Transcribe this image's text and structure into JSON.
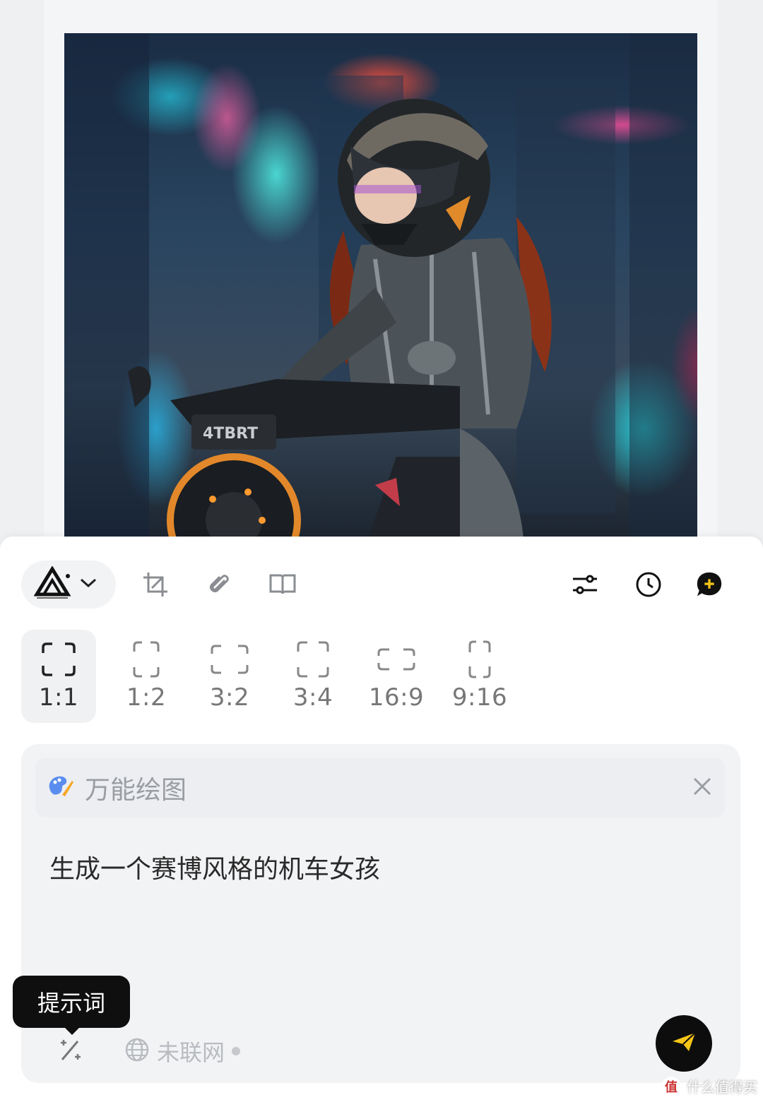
{
  "toolbar": {
    "model_icon": "triangle-logo-icon",
    "dropdown_icon": "chevron-down-icon",
    "left_tools": [
      "crop-icon",
      "paperclip-icon",
      "book-icon"
    ],
    "right_tools": [
      "sliders-icon",
      "clock-icon",
      "new-chat-icon"
    ]
  },
  "ratios": [
    {
      "label": "1:1",
      "active": true
    },
    {
      "label": "1:2",
      "active": false
    },
    {
      "label": "3:2",
      "active": false
    },
    {
      "label": "3:4",
      "active": false
    },
    {
      "label": "16:9",
      "active": false
    },
    {
      "label": "9:16",
      "active": false
    }
  ],
  "prompt": {
    "mode_label": "万能绘图",
    "mode_icon": "palette-icon",
    "text": "生成一个赛博风格的机车女孩"
  },
  "bottom": {
    "tooltip": "提示词",
    "magic_icon": "magic-wand-icon",
    "network_icon": "globe-icon",
    "network_label": "未联网",
    "send_icon": "send-icon"
  },
  "watermark": {
    "text": "什么值得买",
    "logo": "值"
  },
  "colors": {
    "accent": "#f5c518",
    "send_bg": "#0d0d0d"
  }
}
